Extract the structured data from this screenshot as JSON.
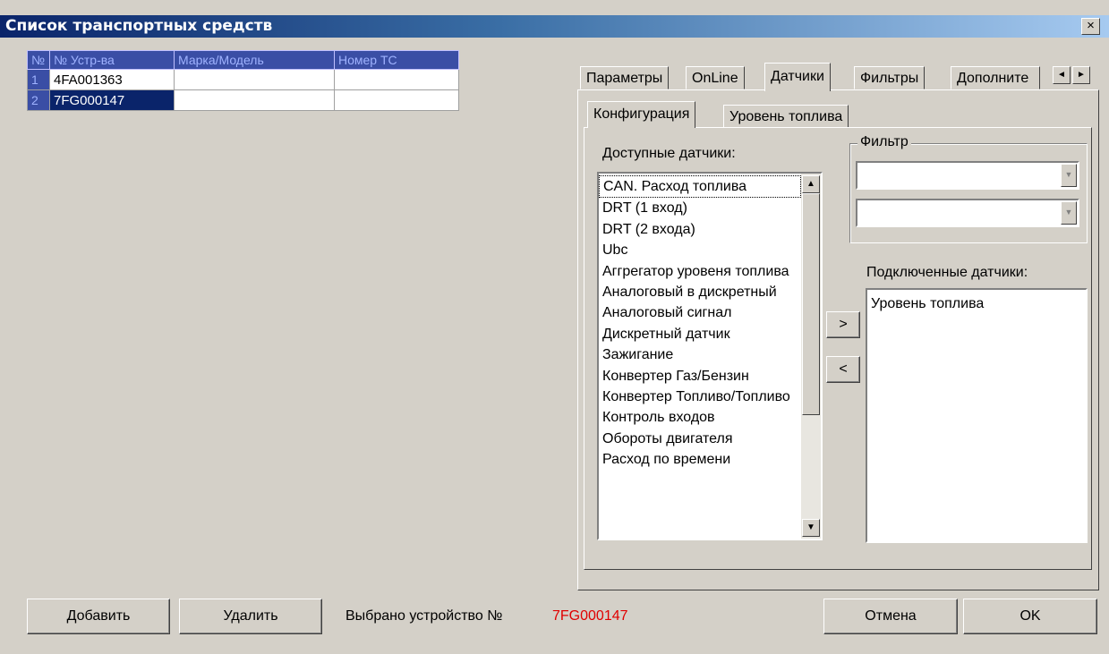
{
  "window": {
    "title": "Список транспортных средств",
    "close_glyph": "×"
  },
  "grid": {
    "headers": [
      "№",
      "№ Устр-ва",
      "Марка/Модель",
      "Номер ТС"
    ],
    "rows": [
      {
        "num": "1",
        "device": "4FA001363",
        "model": "",
        "plate": ""
      },
      {
        "num": "2",
        "device": "7FG000147",
        "model": "",
        "plate": ""
      }
    ]
  },
  "tabs": {
    "items": [
      "Параметры",
      "OnLine",
      "Датчики",
      "Фильтры",
      "Дополните"
    ],
    "active": "Датчики",
    "scroll_left": "◄",
    "scroll_right": "►"
  },
  "subtabs": {
    "items": [
      "Конфигурация",
      "Уровень топлива"
    ],
    "active": "Конфигурация"
  },
  "available": {
    "label": "Доступные датчики:",
    "items": [
      "CAN. Расход топлива",
      "DRT (1 вход)",
      "DRT (2 входа)",
      "Ubc",
      "Аггрегатор уровеня топлива",
      "Аналоговый в дискретный",
      "Аналоговый сигнал",
      "Дискретный датчик",
      "Зажигание",
      "Конвертер Газ/Бензин",
      "Конвертер Топливо/Топливо",
      "Контроль входов",
      "Обороты двигателя",
      "Расход по времени"
    ]
  },
  "filter": {
    "label": "Фильтр",
    "combo1_value": "",
    "combo2_value": ""
  },
  "connected": {
    "label": "Подключенные датчики:",
    "items": [
      "Уровень топлива"
    ]
  },
  "move": {
    "add_label": ">",
    "remove_label": "<"
  },
  "footer": {
    "add_label": "Добавить",
    "delete_label": "Удалить",
    "selected_text": "Выбрано устройство №",
    "selected_value": "7FG000147",
    "cancel_label": "Отмена",
    "ok_label": "OK"
  },
  "colors": {
    "title_start": "#0a246a",
    "selected_value": "#e00000",
    "grid_header": "#3a4ea5"
  },
  "icons": {
    "close": "close-icon",
    "scroll_up": "arrow-up-icon",
    "scroll_down": "arrow-down-icon",
    "combo": "chevron-down-icon"
  }
}
